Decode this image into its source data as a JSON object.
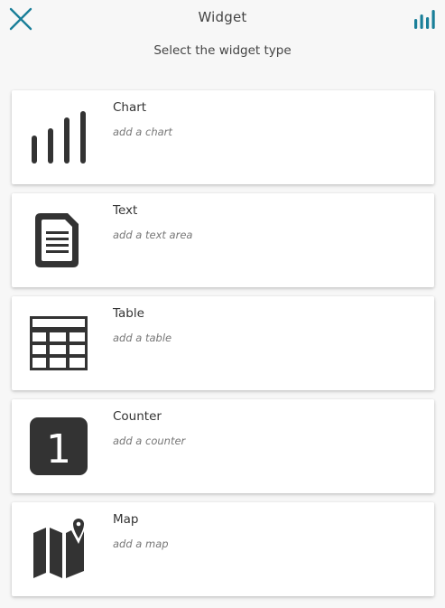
{
  "header": {
    "title": "Widget",
    "subtitle": "Select the widget type",
    "close_icon": "close-icon",
    "chart_icon": "bar-chart-icon"
  },
  "colors": {
    "accent": "#1a7f99",
    "icon_dark": "#333333",
    "card_bg": "#ffffff",
    "page_bg": "#f7f7f7"
  },
  "widgets": [
    {
      "title": "Chart",
      "description": "add a chart",
      "icon": "bar-chart-icon"
    },
    {
      "title": "Text",
      "description": "add a text area",
      "icon": "document-icon"
    },
    {
      "title": "Table",
      "description": "add a table",
      "icon": "table-icon"
    },
    {
      "title": "Counter",
      "description": "add a counter",
      "icon": "counter-icon",
      "icon_text": "1"
    },
    {
      "title": "Map",
      "description": "add a map",
      "icon": "map-icon"
    }
  ]
}
